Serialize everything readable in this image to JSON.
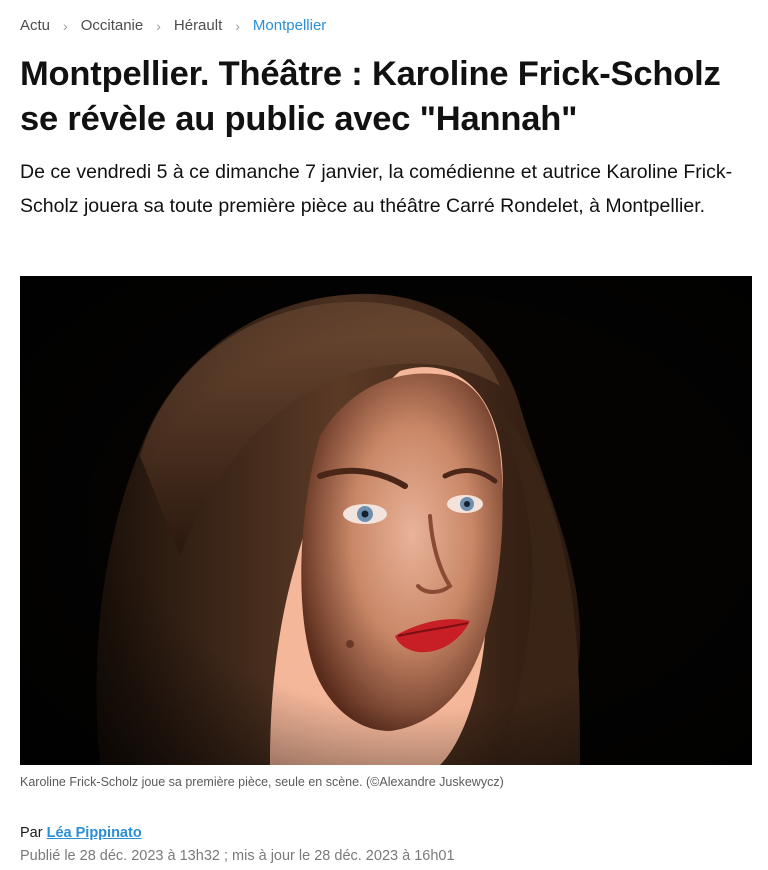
{
  "breadcrumb": {
    "items": [
      "Actu",
      "Occitanie",
      "Hérault"
    ],
    "current": "Montpellier",
    "separator_icon": "chevron-right-icon"
  },
  "article": {
    "title": "Montpellier. Théâtre : Karoline Frick-Scholz se révèle au public avec \"Hannah\"",
    "lead": "De ce vendredi 5 à ce dimanche 7 janvier, la comédienne et autrice Karoline Frick-Scholz jouera sa toute première pièce au théâtre Carré Rondelet, à Montpellier.",
    "image_caption": "Karoline Frick-Scholz joue sa première pièce, seule en scène. (©Alexandre Juskewycz)",
    "byline_prefix": "Par",
    "author": "Léa Pippinato",
    "dates": "Publié le 28 déc. 2023 à 13h32 ; mis à jour le 28 déc. 2023 à 16h01"
  },
  "colors": {
    "link": "#2a8fd8",
    "text": "#111111",
    "muted": "#7a7a7a",
    "photo_background": "#040302"
  }
}
